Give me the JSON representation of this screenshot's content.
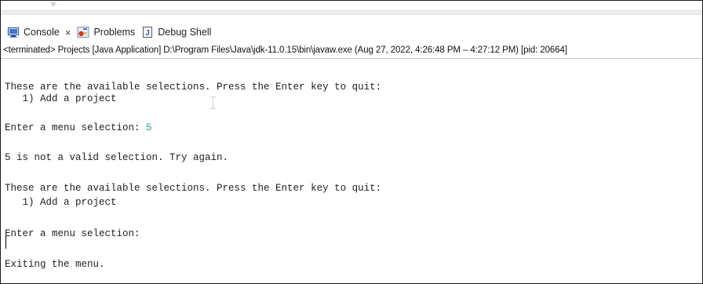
{
  "tabs": [
    {
      "label": "Console",
      "icon": "console-icon",
      "active": true,
      "close": "×"
    },
    {
      "label": "Problems",
      "icon": "problems-icon"
    },
    {
      "label": "Debug Shell",
      "icon": "debug-shell-icon"
    }
  ],
  "process_header": "<terminated> Projects [Java Application] D:\\Program Files\\Java\\jdk-11.0.15\\bin\\javaw.exe  (Aug 27, 2022, 4:26:48 PM – 4:27:12 PM) [pid: 20664]",
  "console": {
    "line1": "These are the available selections. Press the Enter key to quit:",
    "line2": "   1) Add a project",
    "line3_prompt": "Enter a menu selection: ",
    "line3_input": "5",
    "line4": "5 is not a valid selection. Try again.",
    "line5": "These are the available selections. Press the Enter key to quit:",
    "line6": "   1) Add a project",
    "line7": "Enter a menu selection:",
    "line8": "Exiting the menu."
  },
  "colors": {
    "user_input": "#2aa198",
    "console_text": "#1f1f1f"
  }
}
